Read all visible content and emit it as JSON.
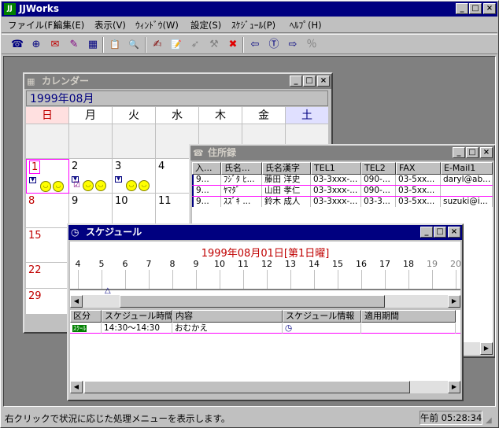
{
  "app": {
    "title": "JJWorks",
    "controls": [
      "_",
      "□",
      "×"
    ]
  },
  "menu": [
    "ファイル(F)",
    "編集(E)",
    "表示(V)",
    "ｳｨﾝﾄﾞｳ(W)",
    "設定(S)",
    "ｽｹｼﾞｭｰﾙ(P)",
    "ﾍﾙﾌﾟ(H)"
  ],
  "toolbar": {
    "icons": [
      "phone-icon",
      "address-icon",
      "mail-icon",
      "pen-icon",
      "calendar-icon",
      "clipboard-icon",
      "search-icon",
      "edit-icon",
      "note-icon",
      "send-icon",
      "tool-icon",
      "delete-icon",
      "back-icon",
      "tag-icon",
      "forward-icon",
      "percent-icon"
    ],
    "glyphs": [
      "☎",
      "⊕",
      "✉",
      "✎",
      "▦",
      "📋",
      "🔍",
      "✍",
      "📝",
      "➶",
      "⚒",
      "✖",
      "⇦",
      "Ⓣ",
      "⇨",
      "％"
    ]
  },
  "calendar": {
    "title": "カレンダー",
    "month": "1999年08月",
    "weekdays": [
      "日",
      "月",
      "火",
      "水",
      "木",
      "金",
      "土"
    ],
    "days": [
      "1",
      "2",
      "3",
      "4",
      "8",
      "9",
      "10",
      "11",
      "15",
      "22",
      "29"
    ]
  },
  "addressbook": {
    "title": "住所録",
    "columns": [
      "入...",
      "氏名...",
      "氏名漢字",
      "TEL1",
      "TEL2",
      "FAX",
      "E-Mail1"
    ],
    "rows": [
      [
        "9...",
        "ﾌｼﾞﾀ ﾋ...",
        "藤田 洋史",
        "03-3xxx-...",
        "090-...",
        "03-5xx...",
        "daryl@ab..."
      ],
      [
        "9...",
        "ﾔﾏﾀﾞ",
        "山田 孝仁",
        "03-3xxx-...",
        "090-...",
        "03-5xx...",
        ""
      ],
      [
        "9...",
        "ｽｽﾞｷ ...",
        "鈴木 成人",
        "03-3xxx-...",
        "03-3...",
        "03-5xx...",
        "suzuki@i..."
      ]
    ]
  },
  "schedule": {
    "title": "スケジュール",
    "date_heading": "1999年08月01日[第1日曜]",
    "hours": [
      "4",
      "5",
      "6",
      "7",
      "8",
      "9",
      "10",
      "11",
      "12",
      "13",
      "14",
      "15",
      "16",
      "17",
      "18",
      "19",
      "20"
    ],
    "columns": [
      "区分",
      "スケジュール時間",
      "内容",
      "スケジュール情報",
      "適用期間"
    ],
    "rows": [
      {
        "kind": "ｽｸｰﾙ",
        "time": "14:30～14:30",
        "content": "おむかえ",
        "info": "clock-icon",
        "period": ""
      }
    ]
  },
  "status": {
    "text": "右クリックで状況に応じた処理メニューを表示します。",
    "clock": "午前 05:28:34"
  },
  "colors": {
    "title_active": "#000080",
    "title_inactive": "#808080",
    "sunday_header": "#ffe0e0",
    "saturday_header": "#e0e0ff",
    "sunday_text": "#c00000",
    "highlight": "#ff00ff"
  }
}
